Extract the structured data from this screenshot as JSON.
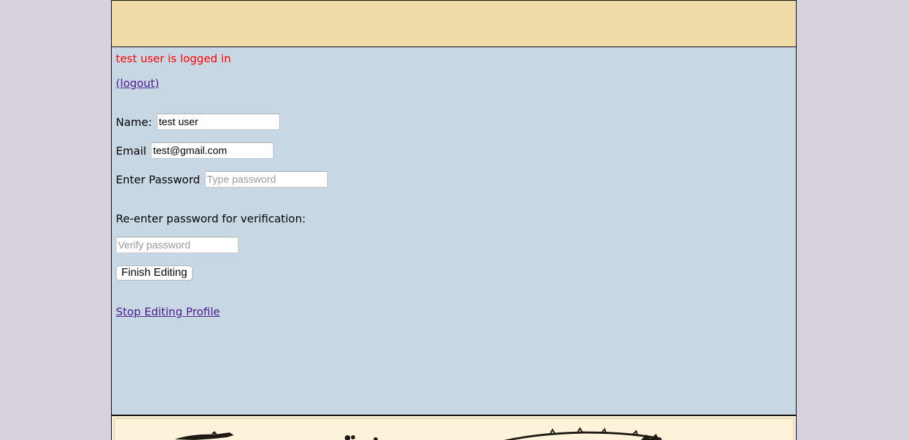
{
  "session": {
    "status_text": "test user is logged in",
    "logout_label": "(logout)"
  },
  "profile_form": {
    "name_label": "Name:",
    "name_value": "test user",
    "email_label": "Email",
    "email_value": "test@gmail.com",
    "password_label": "Enter Password",
    "password_placeholder": "Type password",
    "verify_label": "Re-enter password for verification:",
    "verify_placeholder": "Verify password",
    "finish_button": "Finish Editing",
    "stop_editing_link": "Stop Editing Profile"
  },
  "colors": {
    "banner": "#f0dca8",
    "content": "#c8d7e4",
    "status": "#ff0000",
    "link": "#4b1a8a",
    "outer_background": "#d8d2de"
  }
}
